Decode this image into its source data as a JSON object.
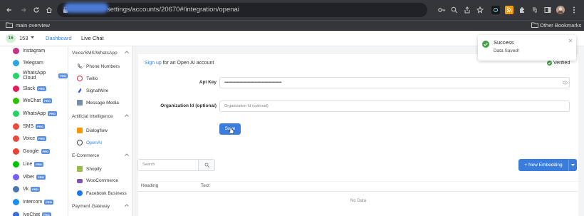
{
  "browser": {
    "url_prefix": "/",
    "url": "settings/accounts/20670#/integration/openai",
    "bookmark_item": "main overview",
    "other_bookmarks": "Other Bookmarks"
  },
  "topnav": {
    "badge": "16",
    "count": "153",
    "dashboard": "Dashboard",
    "live_chat": "Live Chat"
  },
  "sidebar": {
    "pro_label": "PRO",
    "items": [
      {
        "label": "Instagram",
        "pro": false,
        "color": "#c13584"
      },
      {
        "label": "Telegram",
        "pro": false,
        "color": "#2aa3df"
      },
      {
        "label": "WhatsApp Cloud",
        "pro": true,
        "color": "#25d366"
      },
      {
        "label": "Slack",
        "pro": true,
        "color": "#e01e5a"
      },
      {
        "label": "WeChat",
        "pro": true,
        "color": "#2dc100"
      },
      {
        "label": "WhatsApp",
        "pro": true,
        "color": "#25d366"
      },
      {
        "label": "SMS",
        "pro": true,
        "color": "#e74c3c"
      },
      {
        "label": "Voice",
        "pro": true,
        "color": "#e74c3c"
      },
      {
        "label": "Google",
        "pro": true,
        "color": "#ea4335"
      },
      {
        "label": "Line",
        "pro": true,
        "color": "#00c300"
      },
      {
        "label": "Viber",
        "pro": true,
        "color": "#7360f2"
      },
      {
        "label": "Vk",
        "pro": true,
        "color": "#4a76a8"
      },
      {
        "label": "Intercom",
        "pro": true,
        "color": "#1f8ded"
      },
      {
        "label": "IvoChat",
        "pro": true,
        "color": "#3c6fd8"
      }
    ]
  },
  "subnav": {
    "section1": "Voice/SMS/WhatsApp",
    "phone_numbers": "Phone Numbers",
    "twilio": "Twilio",
    "signalwire": "SignalWire",
    "message_media": "Message Media",
    "section2": "Artificial Intelligence",
    "dialogflow": "Dialogflow",
    "openai": "OpenAI",
    "section3": "E-Commerce",
    "shopify": "Shopify",
    "woocommerce": "WooCommerce",
    "facebook_business": "Facebook Business",
    "section4": "Payment Gateway"
  },
  "form": {
    "signup_link": "Sign up",
    "signup_rest": "for an Open AI account",
    "verified": "Verified",
    "api_key_label": "Api Key",
    "api_key_value": "••••••••••••••••••••••••••••••••••••••••••••••••••••••••••••••••",
    "org_label": "Organization Id (optional)",
    "org_placeholder": "Organization Id (optional)",
    "save_button": "Save"
  },
  "table": {
    "search_placeholder": "Search",
    "new_embedding": "+ New Embedding",
    "col_heading": "Heading",
    "col_text": "Text",
    "empty_text": "No Data"
  },
  "toast": {
    "title": "Success",
    "message": "Data Saved!"
  },
  "colors": {
    "accent": "#3b7ddd",
    "success": "#43a047"
  }
}
